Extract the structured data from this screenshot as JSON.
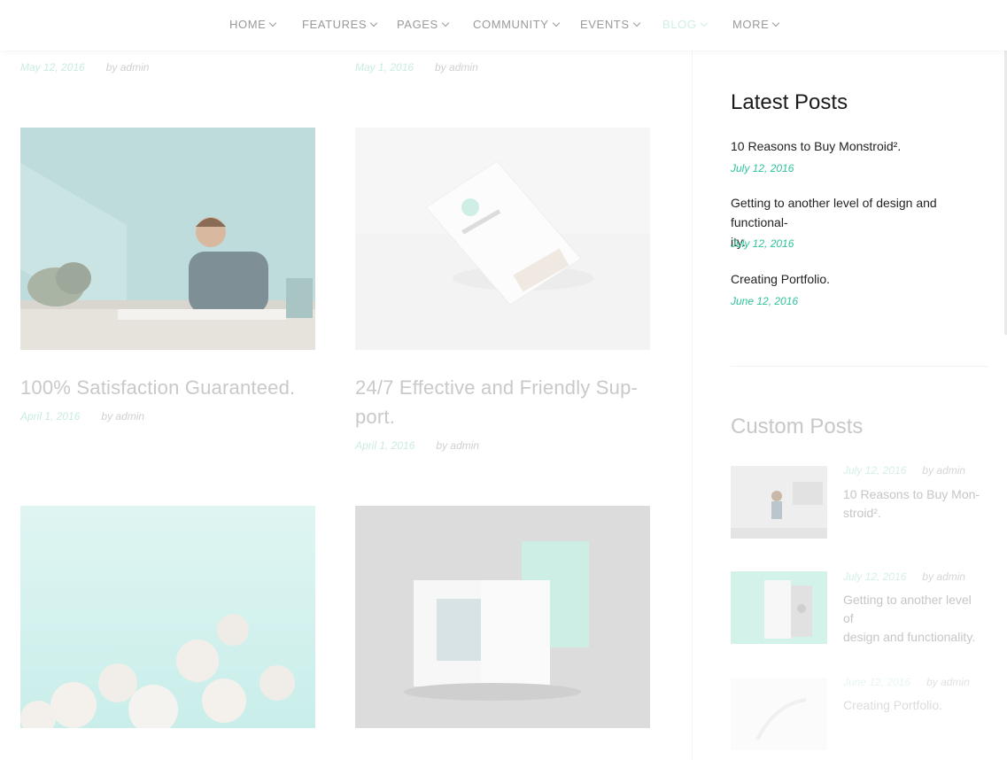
{
  "nav": {
    "items": [
      {
        "label": "HOME"
      },
      {
        "label": "FEATURES"
      },
      {
        "label": "PAGES"
      },
      {
        "label": "COMMUNITY"
      },
      {
        "label": "EVENTS"
      },
      {
        "label": "BLOG",
        "active": true
      },
      {
        "label": "MORE"
      }
    ]
  },
  "posts_top": [
    {
      "date": "May 12, 2016",
      "author": "by admin"
    },
    {
      "date": "May 1, 2016",
      "author": "by admin"
    }
  ],
  "posts": [
    {
      "title": "100% Satisfaction Guaranteed.",
      "date": "April 1, 2016",
      "author": "by admin"
    },
    {
      "title": "24/7 Effective and Friendly Sup-port.",
      "title_line1": "24/7 Effective and Friendly Sup-",
      "title_line2": "port.",
      "date": "April 1, 2016",
      "author": "by admin"
    }
  ],
  "sidebar": {
    "latest_heading": "Latest Posts",
    "latest": [
      {
        "title": "10 Reasons to Buy Monstroid².",
        "date": "July 12, 2016"
      },
      {
        "title": "Getting to another level of design and functional-ity.",
        "title_line1": "Getting to another level of design and functional-",
        "title_line2": "ity.",
        "date": "July 12, 2016"
      },
      {
        "title": "Creating Portfolio.",
        "date": "June 12, 2016"
      }
    ],
    "custom_heading": "Custom Posts",
    "custom": [
      {
        "date": "July 12, 2016",
        "author": "by admin",
        "title_line1": "10 Reasons to Buy Mon-",
        "title_line2": "stroid²."
      },
      {
        "date": "July 12, 2016",
        "author": "by admin",
        "title_line1": "Getting to another level of",
        "title_line2": "design and functionality."
      },
      {
        "date": "June 12, 2016",
        "author": "by admin",
        "title_line1": "Creating Portfolio.",
        "title_line2": ""
      }
    ]
  },
  "colors": {
    "accent": "#2fc49c",
    "accent_faded": "#c8ece2",
    "nav_text": "#9a9a9a"
  }
}
